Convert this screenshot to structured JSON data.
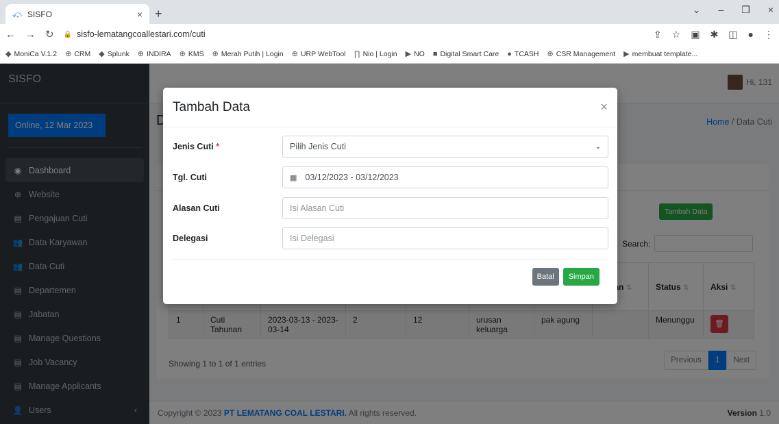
{
  "browser": {
    "tab_title": "SISFO",
    "url": "sisfo-lematangcoallestari.com/cuti",
    "bookmarks": [
      "MoniCa V.1.2",
      "CRM",
      "Splunk",
      "INDIRA",
      "KMS",
      "Merah Putih | Login",
      "URP WebTool",
      "Nio | Login",
      "NO",
      "Digital Smart Care",
      "TCASH",
      "CSR Management",
      "membuat template..."
    ]
  },
  "sidebar": {
    "brand": "SISFO",
    "online": "Online, 12 Mar 2023",
    "items": [
      {
        "label": "Dashboard",
        "icon": "dashboard-icon"
      },
      {
        "label": "Website",
        "icon": "globe-icon"
      },
      {
        "label": "Pengajuan Cuti",
        "icon": "list-icon"
      },
      {
        "label": "Data Karyawan",
        "icon": "users-icon"
      },
      {
        "label": "Data Cuti",
        "icon": "users-icon"
      },
      {
        "label": "Departemen",
        "icon": "list-icon"
      },
      {
        "label": "Jabatan",
        "icon": "list-icon"
      },
      {
        "label": "Manage Questions",
        "icon": "list-icon"
      },
      {
        "label": "Job Vacancy",
        "icon": "list-icon"
      },
      {
        "label": "Manage Applicants",
        "icon": "list-icon"
      },
      {
        "label": "Users",
        "icon": "user-icon"
      }
    ]
  },
  "header": {
    "user": "Hi, 131",
    "page_title": "D",
    "crumb_home": "Home",
    "crumb_sep": "/",
    "crumb_current": "Data Cuti"
  },
  "card": {
    "add_button": "Tambah Data",
    "search_label": "Search:",
    "columns": [
      "",
      "",
      "",
      "",
      "",
      "",
      "",
      "atatan",
      "Status",
      "Aksi"
    ],
    "row": {
      "no": "1",
      "jenis": "Cuti Tahunan",
      "tgl": "2023-03-13 - 2023-03-14",
      "lama": "2",
      "sisa": "12",
      "alasan": "urusan keluarga",
      "delegasi": "pak agung",
      "catatan": "",
      "status": "Menunggu"
    },
    "showing": "Showing 1 to 1 of 1 entries",
    "pager": {
      "prev": "Previous",
      "page": "1",
      "next": "Next"
    }
  },
  "footer": {
    "copyright": "Copyright © 2023",
    "company": "PT LEMATANG COAL LESTARI.",
    "rights": "All rights reserved.",
    "version_label": "Version",
    "version": "1.0"
  },
  "modal": {
    "title": "Tambah Data",
    "close": "×",
    "jenis_label": "Jenis Cuti",
    "required_mark": "*",
    "jenis_value": "Pilih Jenis Cuti",
    "tgl_label": "Tgl. Cuti",
    "tgl_value": "03/12/2023 - 03/12/2023",
    "alasan_label": "Alasan Cuti",
    "alasan_placeholder": "Isi Alasan Cuti",
    "delegasi_label": "Delegasi",
    "delegasi_placeholder": "Isi Delegasi",
    "batal": "Batal",
    "simpan": "Simpan"
  }
}
